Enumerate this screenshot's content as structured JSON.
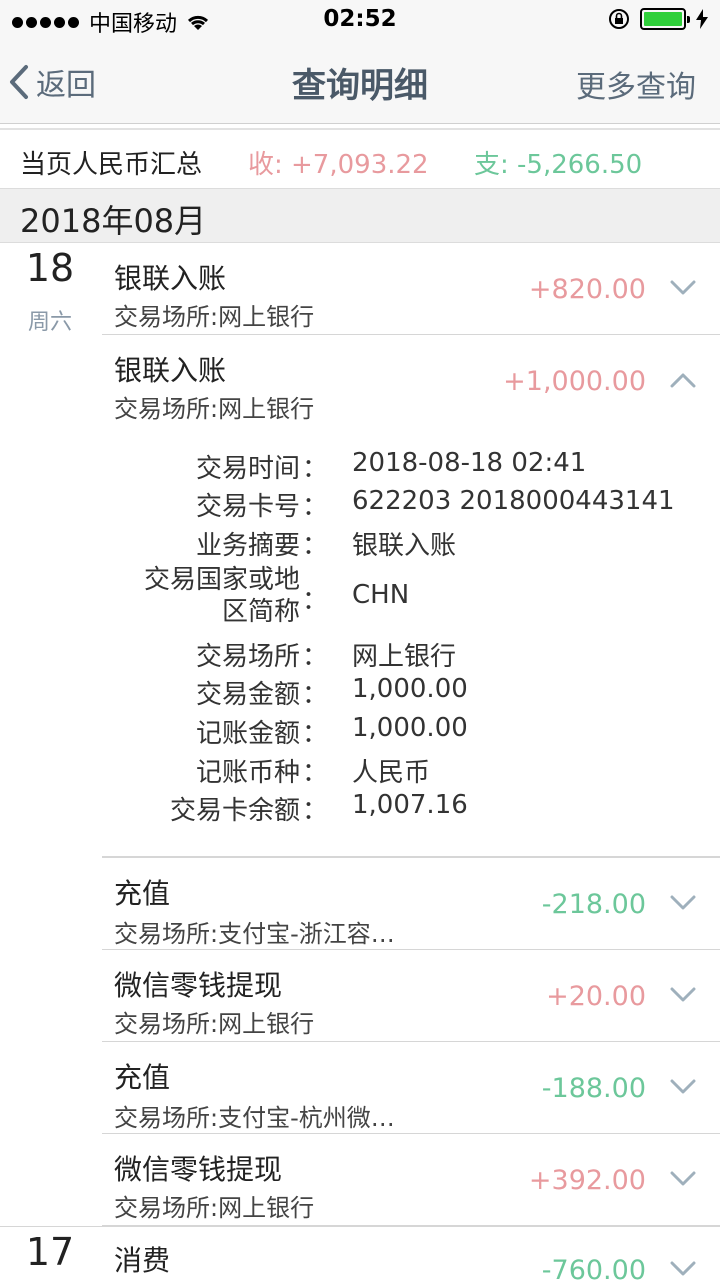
{
  "status_bar": {
    "carrier": "中国移动",
    "time": "02:52",
    "battery_level": 1.0,
    "icons": [
      "signal-dots-icon",
      "wifi-icon",
      "orientation-lock-icon",
      "battery-icon",
      "charging-bolt-icon"
    ]
  },
  "nav": {
    "back_label": "返回",
    "title": "查询明细",
    "more_label": "更多查询"
  },
  "summary": {
    "label": "当页人民币汇总",
    "income": "收: +7,093.22",
    "expense": "支: -5,266.50"
  },
  "colors": {
    "income": "#e89a9e",
    "expense": "#6cc79a",
    "nav_text": "#5b6b7b",
    "weekday": "#8a99a8"
  },
  "month": "2018年08月",
  "days": [
    {
      "date": "18",
      "weekday": "周六"
    },
    {
      "date": "17"
    }
  ],
  "transactions": [
    {
      "title": "银联入账",
      "place": "交易场所:网上银行",
      "amount": "+820.00",
      "sign": "positive",
      "expanded": false
    },
    {
      "title": "银联入账",
      "place": "交易场所:网上银行",
      "amount": "+1,000.00",
      "sign": "positive",
      "expanded": true
    },
    {
      "title": "充值",
      "place": "交易场所:支付宝-浙江容…",
      "amount": "-218.00",
      "sign": "negative",
      "expanded": false
    },
    {
      "title": "微信零钱提现",
      "place": "交易场所:网上银行",
      "amount": "+20.00",
      "sign": "positive",
      "expanded": false
    },
    {
      "title": "充值",
      "place": "交易场所:支付宝-杭州微…",
      "amount": "-188.00",
      "sign": "negative",
      "expanded": false
    },
    {
      "title": "微信零钱提现",
      "place": "交易场所:网上银行",
      "amount": "+392.00",
      "sign": "positive",
      "expanded": false
    },
    {
      "title": "消费",
      "amount": "-760.00",
      "sign": "negative",
      "expanded": false
    }
  ],
  "details": [
    {
      "label": "交易时间",
      "value": "2018-08-18 02:41"
    },
    {
      "label": "交易卡号",
      "value": "622203 2018000443141"
    },
    {
      "label": "业务摘要",
      "value": "银联入账"
    },
    {
      "label_line1": "交易国家或地",
      "label_line2": "区简称",
      "value": "CHN"
    },
    {
      "label": "交易场所",
      "value": "网上银行"
    },
    {
      "label": "交易金额",
      "value": "1,000.00"
    },
    {
      "label": "记账金额",
      "value": "1,000.00"
    },
    {
      "label": "记账币种",
      "value": "人民币"
    },
    {
      "label": "交易卡余额",
      "value": "1,007.16"
    }
  ],
  "detail_colon": "："
}
